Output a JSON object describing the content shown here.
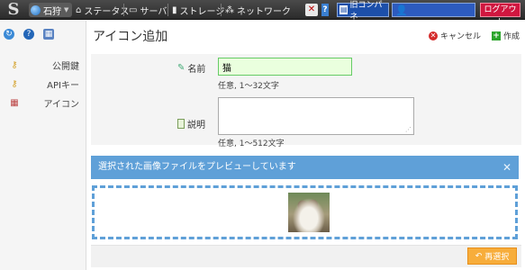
{
  "topbar": {
    "zone": "石狩",
    "nav": [
      {
        "label": "ステータス",
        "icon": "house-icon"
      },
      {
        "label": "サーバ",
        "icon": "monitor-icon"
      },
      {
        "label": "ストレージ",
        "icon": "disk-icon"
      },
      {
        "label": "ネットワーク",
        "icon": "network-icon"
      }
    ],
    "old_cp": "旧コンパネ",
    "logout": "ログアウト"
  },
  "sidebar": {
    "items": [
      {
        "label": "公開鍵",
        "icon": "key-icon"
      },
      {
        "label": "APIキー",
        "icon": "key-icon"
      },
      {
        "label": "アイコン",
        "icon": "icon-grid-icon"
      }
    ]
  },
  "main": {
    "title": "アイコン追加",
    "cancel": "キャンセル",
    "create": "作成",
    "form": {
      "name_label": "名前",
      "name_value": "猫",
      "name_hint": "任意, 1〜32文字",
      "desc_label": "説明",
      "desc_value": "",
      "desc_hint": "任意, 1〜512文字"
    },
    "notice": "選択された画像ファイルをプレビューしています",
    "reselect": "再選択"
  },
  "colors": {
    "accent": "#5fa0d8",
    "logout": "#d0163f",
    "reselect": "#f7ad3b"
  }
}
